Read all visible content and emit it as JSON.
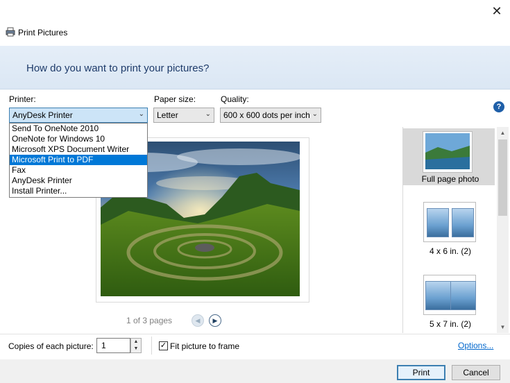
{
  "window": {
    "title": "Print Pictures",
    "close_glyph": "✕"
  },
  "header": {
    "question": "How do you want to print your pictures?"
  },
  "printer": {
    "label": "Printer:",
    "selected": "AnyDesk Printer",
    "options": [
      "Send To OneNote 2010",
      "OneNote for Windows 10",
      "Microsoft XPS Document Writer",
      "Microsoft Print to PDF",
      "Fax",
      "AnyDesk Printer",
      "Install Printer..."
    ],
    "highlighted_option": "Microsoft Print to PDF"
  },
  "paper": {
    "label": "Paper size:",
    "selected": "Letter"
  },
  "quality": {
    "label": "Quality:",
    "selected": "600 x 600 dots per inch"
  },
  "help_glyph": "?",
  "preview": {
    "page_count": "1 of 3 pages",
    "prev_glyph": "◀",
    "next_glyph": "▶"
  },
  "layouts": [
    {
      "label": "Full page photo",
      "selected": true
    },
    {
      "label": "4 x 6 in. (2)",
      "selected": false
    },
    {
      "label": "5 x 7 in. (2)",
      "selected": false
    }
  ],
  "scroll": {
    "up_glyph": "▲",
    "down_glyph": "▼"
  },
  "bottom": {
    "copies_label": "Copies of each picture:",
    "copies_value": "1",
    "fit_label": "Fit picture to frame",
    "fit_checked_glyph": "✓",
    "options_link": "Options...",
    "print_label": "Print",
    "cancel_label": "Cancel"
  },
  "colors": {
    "accent": "#0078d7",
    "header_text": "#1e3b6a",
    "link": "#0066cc"
  }
}
